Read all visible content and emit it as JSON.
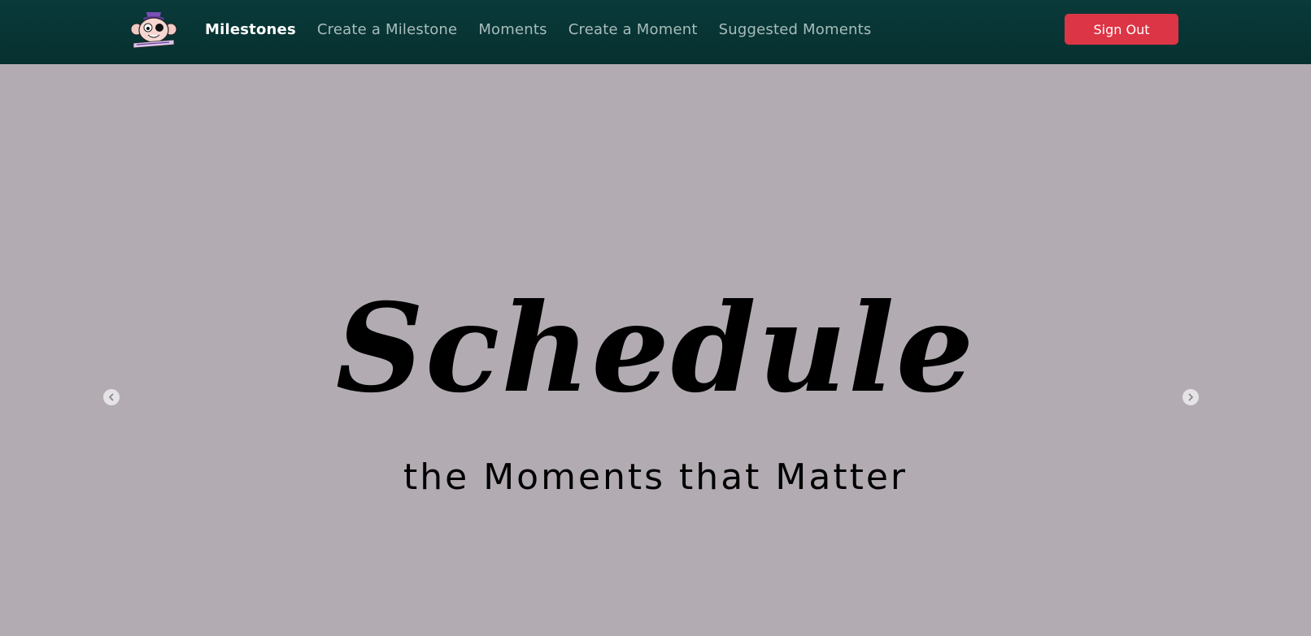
{
  "nav": {
    "items": [
      {
        "label": "Milestones",
        "active": true
      },
      {
        "label": "Create a Milestone",
        "active": false
      },
      {
        "label": "Moments",
        "active": false
      },
      {
        "label": "Create a Moment",
        "active": false
      },
      {
        "label": "Suggested Moments",
        "active": false
      }
    ],
    "signout_label": "Sign Out"
  },
  "hero": {
    "title": "Schedule",
    "subtitle": "the Moments that Matter"
  },
  "colors": {
    "navbar": "#06302f",
    "background": "#b2acb2",
    "signout": "#dc3545",
    "nav_link": "#a9bcbc",
    "nav_active": "#ffffff"
  },
  "icons": {
    "logo": "monkey-mascot-logo",
    "prev": "chevron-left-icon",
    "next": "chevron-right-icon"
  }
}
